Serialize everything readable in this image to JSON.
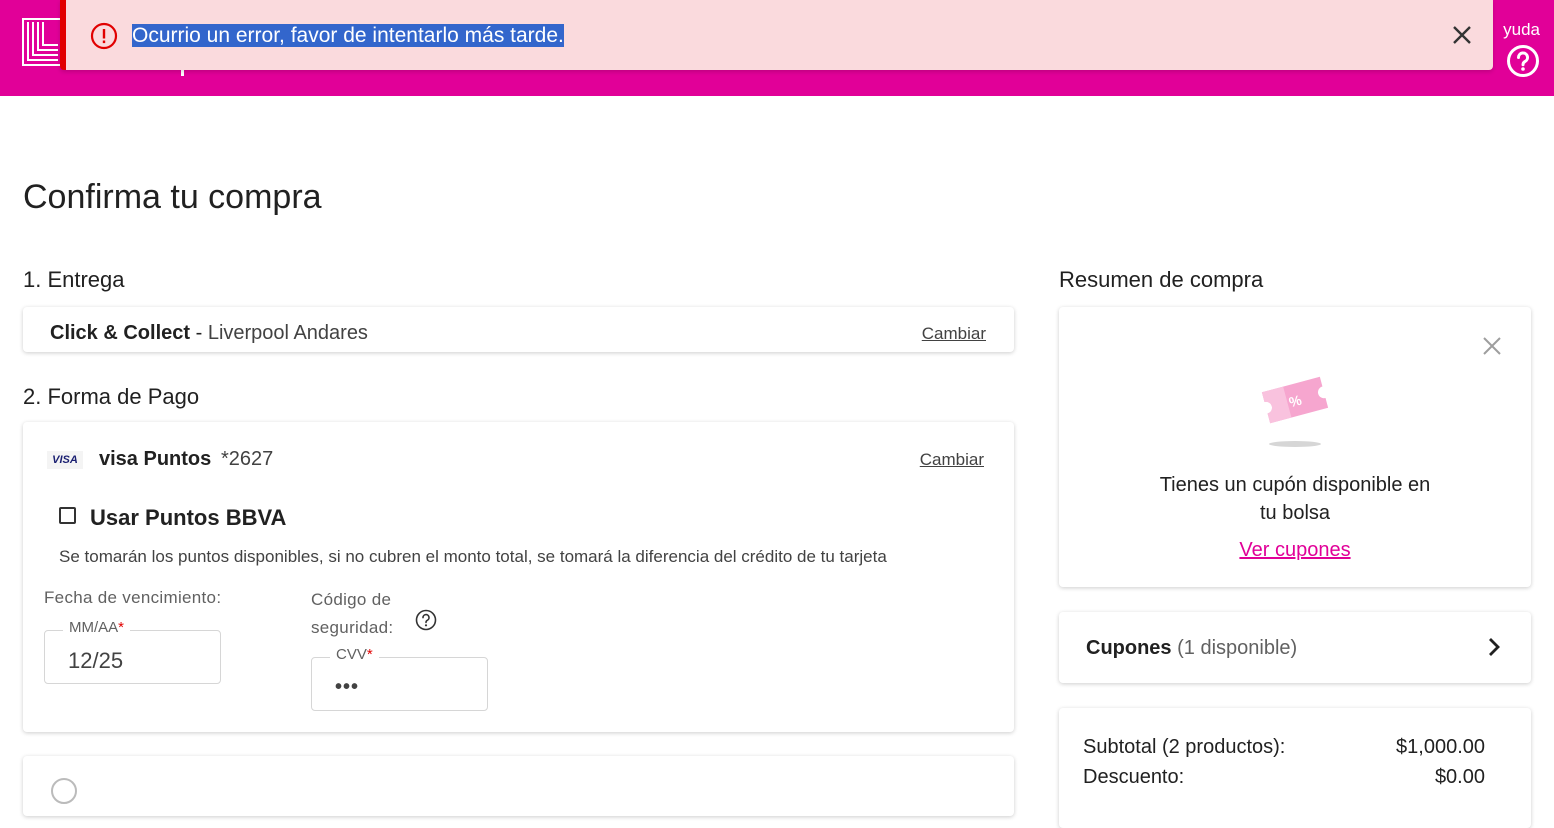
{
  "header": {
    "help_label": "yuda",
    "brand_color": "#e10098"
  },
  "toast": {
    "message": "Ocurrio un error, favor de intentarlo más tarde.",
    "icon": "error-icon",
    "close_icon": "close-icon",
    "accent_color": "#e10000"
  },
  "page_title": "Confirma tu compra",
  "delivery": {
    "section_title": "1. Entrega",
    "method": "Click & Collect",
    "separator": " - ",
    "store": "Liverpool Andares",
    "change_link": "Cambiar"
  },
  "payment": {
    "section_title": "2. Forma de Pago",
    "card_logo": "VISA",
    "card_name": "visa Puntos",
    "card_number": "*2627",
    "change_link": "Cambiar",
    "use_points_label": "Usar Puntos BBVA",
    "use_points_checked": false,
    "points_note": "Se tomarán los puntos disponibles, si no cubren el monto total, se tomará la diferencia del crédito de tu tarjeta",
    "expiry_label": "Fecha de vencimiento:",
    "expiry_legend": "MM/AA",
    "expiry_value": "12/25",
    "cvv_label": "Código de seguridad:",
    "cvv_legend": "CVV",
    "cvv_value": "•••",
    "required_mark": "*"
  },
  "summary": {
    "section_title": "Resumen de compra",
    "promo_text": "Tienes un cupón disponible en tu bolsa",
    "promo_link": "Ver cupones",
    "coupon_icon": "coupon-ticket-icon",
    "coupons_label": "Cupones",
    "coupons_count": "(1 disponible)",
    "subtotal_label": "Subtotal (2 productos):",
    "subtotal_value": "$1,000.00",
    "discount_label": "Descuento:",
    "discount_value": "$0.00"
  }
}
